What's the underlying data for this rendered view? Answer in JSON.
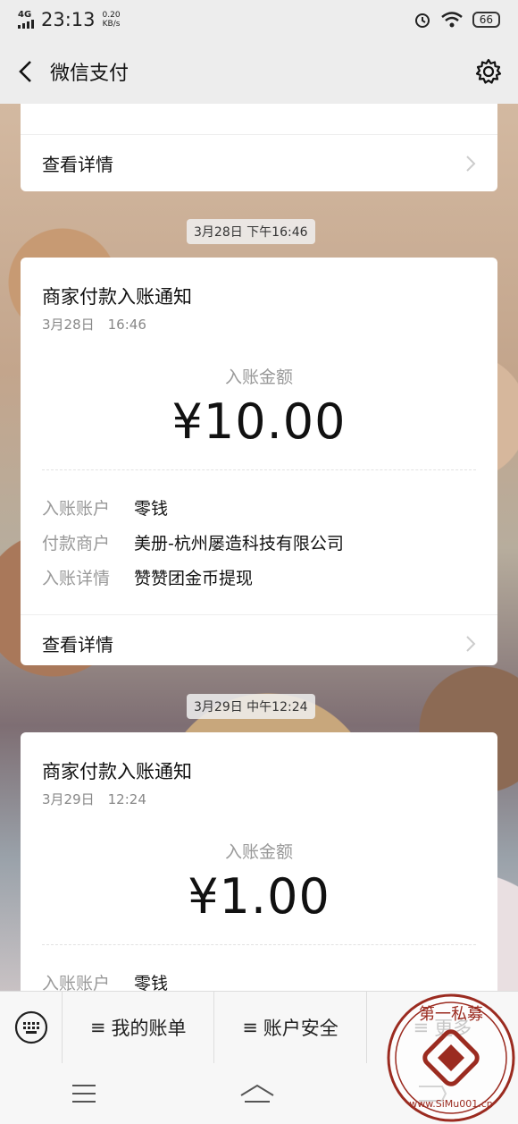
{
  "status": {
    "network": "4G",
    "time": "23:13",
    "speed_value": "0.20",
    "speed_unit": "KB/s",
    "battery": "66"
  },
  "nav": {
    "title": "微信支付"
  },
  "card0": {
    "detail_label": "查看详情"
  },
  "timestamps": [
    "3月28日 下午16:46",
    "3月29日 中午12:24"
  ],
  "card1": {
    "title": "商家付款入账通知",
    "date": "3月28日　16:46",
    "amount_label": "入账金额",
    "amount": "¥10.00",
    "rows": [
      {
        "k": "入账账户",
        "v": "零钱"
      },
      {
        "k": "付款商户",
        "v": "美册-杭州屡造科技有限公司"
      },
      {
        "k": "入账详情",
        "v": "赞赞团金币提现"
      }
    ],
    "detail_label": "查看详情"
  },
  "card2": {
    "title": "商家付款入账通知",
    "date": "3月29日　12:24",
    "amount_label": "入账金额",
    "amount": "¥1.00",
    "rows": [
      {
        "k": "入账账户",
        "v": "零钱"
      }
    ]
  },
  "menu": {
    "bill": "我的账单",
    "security": "账户安全",
    "more": "更多"
  },
  "watermark": {
    "text_top": "第一私募",
    "text_bottom": "www.SiMu001.cn"
  }
}
